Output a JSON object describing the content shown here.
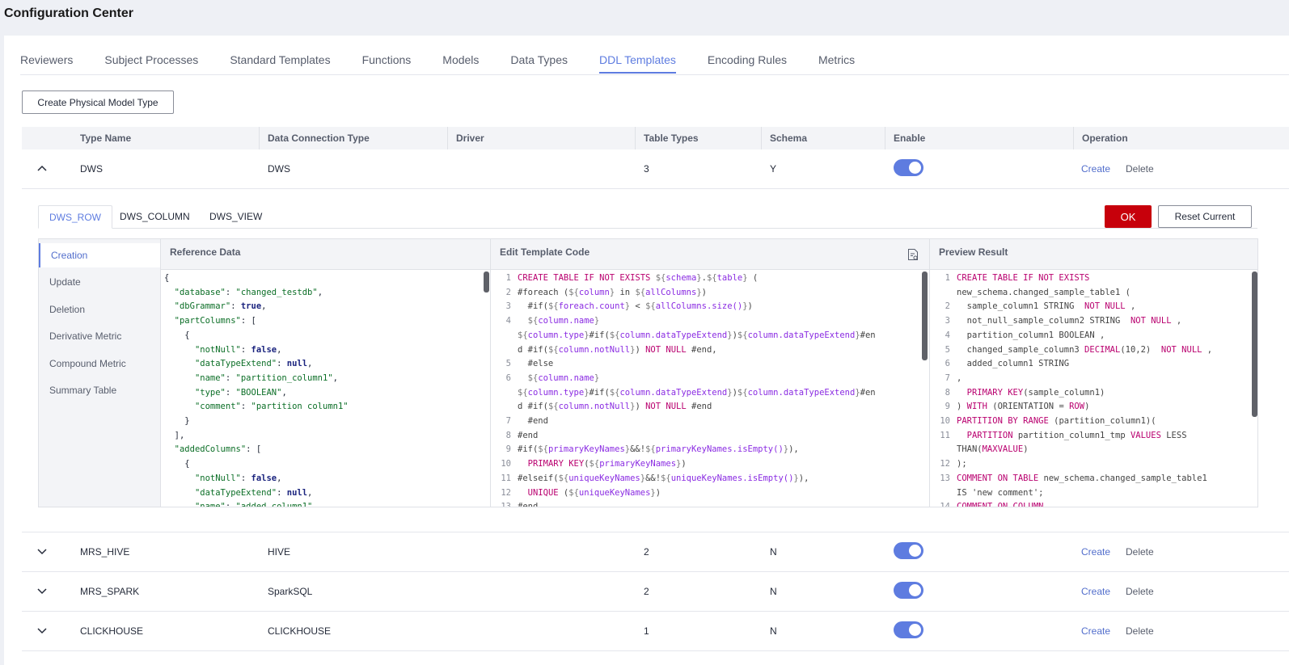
{
  "page_title": "Configuration Center",
  "tabs": [
    "Reviewers",
    "Subject Processes",
    "Standard Templates",
    "Functions",
    "Models",
    "Data Types",
    "DDL Templates",
    "Encoding Rules",
    "Metrics"
  ],
  "active_tab": "DDL Templates",
  "create_button": "Create Physical Model Type",
  "columns": {
    "type_name": "Type Name",
    "conn_type": "Data Connection Type",
    "driver": "Driver",
    "table_types": "Table Types",
    "schema": "Schema",
    "enable": "Enable",
    "operation": "Operation"
  },
  "rows": [
    {
      "name": "DWS",
      "conn": "DWS",
      "driver": "",
      "table_types": "3",
      "schema": "Y",
      "enabled": true,
      "expanded": true
    },
    {
      "name": "MRS_HIVE",
      "conn": "HIVE",
      "driver": "",
      "table_types": "2",
      "schema": "N",
      "enabled": true,
      "expanded": false
    },
    {
      "name": "MRS_SPARK",
      "conn": "SparkSQL",
      "driver": "",
      "table_types": "2",
      "schema": "N",
      "enabled": true,
      "expanded": false
    },
    {
      "name": "CLICKHOUSE",
      "conn": "CLICKHOUSE",
      "driver": "",
      "table_types": "1",
      "schema": "N",
      "enabled": true,
      "expanded": false
    }
  ],
  "op_create": "Create",
  "op_delete": "Delete",
  "sub_tabs": [
    "DWS_ROW",
    "DWS_COLUMN",
    "DWS_VIEW"
  ],
  "ok_button": "OK",
  "reset_button": "Reset Current",
  "side_menu": [
    "Creation",
    "Update",
    "Deletion",
    "Derivative Metric",
    "Compound Metric",
    "Summary Table"
  ],
  "panels": {
    "reference": "Reference Data",
    "edit": "Edit Template Code",
    "preview": "Preview Result"
  },
  "reference_lines": [
    "{",
    "  \"database\": \"changed_testdb\",",
    "  \"dbGrammar\": true,",
    "  \"partColumns\": [",
    "    {",
    "      \"notNull\": false,",
    "      \"dataTypeExtend\": null,",
    "      \"name\": \"partition_column1\",",
    "      \"type\": \"BOOLEAN\",",
    "      \"comment\": \"partition column1\"",
    "    }",
    "  ],",
    "  \"addedColumns\": [",
    "    {",
    "      \"notNull\": false,",
    "      \"dataTypeExtend\": null,",
    "      \"name\": \"added_column1\","
  ],
  "edit_lines": [
    {
      "n": "1",
      "t": "CREATE TABLE IF NOT EXISTS ${schema}.${table} ("
    },
    {
      "n": "2",
      "t": "#foreach (${column} in ${allColumns})"
    },
    {
      "n": "3",
      "t": "  #if(${foreach.count} < ${allColumns.size()})"
    },
    {
      "n": "4",
      "t": "  ${column.name}"
    },
    {
      "n": "",
      "t": "${column.type}#if(${column.dataTypeExtend})${column.dataTypeExtend}#en"
    },
    {
      "n": "",
      "t": "d #if(${column.notNull}) NOT NULL #end,"
    },
    {
      "n": "5",
      "t": "  #else"
    },
    {
      "n": "6",
      "t": "  ${column.name}"
    },
    {
      "n": "",
      "t": "${column.type}#if(${column.dataTypeExtend})${column.dataTypeExtend}#en"
    },
    {
      "n": "",
      "t": "d #if(${column.notNull}) NOT NULL #end"
    },
    {
      "n": "7",
      "t": "  #end"
    },
    {
      "n": "8",
      "t": "#end"
    },
    {
      "n": "9",
      "t": "#if(${primaryKeyNames}&&!${primaryKeyNames.isEmpty()}),"
    },
    {
      "n": "10",
      "t": "  PRIMARY KEY(${primaryKeyNames})"
    },
    {
      "n": "11",
      "t": "#elseif(${uniqueKeyNames}&&!${uniqueKeyNames.isEmpty()}),"
    },
    {
      "n": "12",
      "t": "  UNIQUE (${uniqueKeyNames})"
    },
    {
      "n": "13",
      "t": "#end"
    }
  ],
  "preview_lines": [
    {
      "n": "1",
      "t": "CREATE TABLE IF NOT EXISTS"
    },
    {
      "n": "",
      "t": "new_schema.changed_sample_table1 ("
    },
    {
      "n": "2",
      "t": "  sample_column1 STRING  NOT NULL ,"
    },
    {
      "n": "3",
      "t": "  not_null_sample_column2 STRING  NOT NULL ,"
    },
    {
      "n": "4",
      "t": "  partition_column1 BOOLEAN ,"
    },
    {
      "n": "5",
      "t": "  changed_sample_column3 DECIMAL(10,2)  NOT NULL ,"
    },
    {
      "n": "6",
      "t": "  added_column1 STRING"
    },
    {
      "n": "7",
      "t": ","
    },
    {
      "n": "8",
      "t": "  PRIMARY KEY(sample_column1)"
    },
    {
      "n": "9",
      "t": ") WITH (ORIENTATION = ROW)"
    },
    {
      "n": "10",
      "t": "PARTITION BY RANGE (partition_column1)("
    },
    {
      "n": "11",
      "t": "  PARTITION partition_column1_tmp VALUES LESS"
    },
    {
      "n": "",
      "t": "THAN(MAXVALUE)"
    },
    {
      "n": "12",
      "t": ");"
    },
    {
      "n": "13",
      "t": "COMMENT ON TABLE new_schema.changed_sample_table1"
    },
    {
      "n": "",
      "t": "IS 'new comment';"
    },
    {
      "n": "14",
      "t": "COMMENT ON COLUMN"
    }
  ],
  "colors": {
    "accent": "#5e7ce0",
    "ok": "#c7000b",
    "link": "#526ecc"
  },
  "icons": {
    "expand": "chevron-up-icon",
    "collapse": "chevron-down-icon",
    "preview": "document-preview-icon"
  }
}
